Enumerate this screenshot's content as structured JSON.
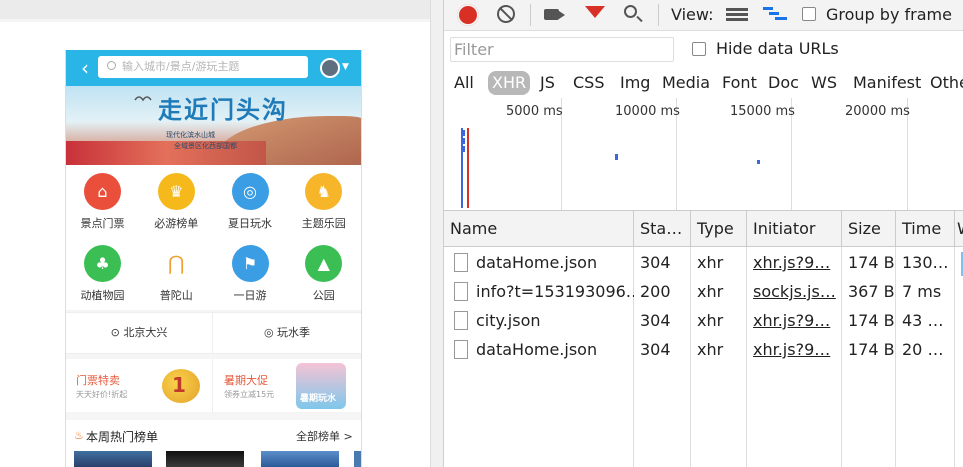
{
  "phone": {
    "back_icon": "‹",
    "search_placeholder": "输入城市/景点/游玩主题",
    "banner": {
      "title": "走近门头沟",
      "sub1": "现代化滨水山城",
      "sub2": "全域景区化西部国都"
    },
    "grid": [
      {
        "label": "景点门票",
        "icon": "temple-icon",
        "color": "#e94f3a",
        "glyph": "⌂"
      },
      {
        "label": "必游榜单",
        "icon": "crown-icon",
        "color": "#f5b91c",
        "glyph": "♛"
      },
      {
        "label": "夏日玩水",
        "icon": "diving-mask-icon",
        "color": "#3b9de3",
        "glyph": "◎"
      },
      {
        "label": "主题乐园",
        "icon": "rocking-horse-icon",
        "color": "#f7b52a",
        "glyph": "♞"
      },
      {
        "label": "动植物园",
        "icon": "tree-icon",
        "color": "#3bbf55",
        "glyph": "♣"
      },
      {
        "label": "普陀山",
        "icon": "mountain-icon",
        "color": "#ffffff",
        "glyph": "⋂"
      },
      {
        "label": "一日游",
        "icon": "flag-icon",
        "color": "#3b9de3",
        "glyph": "⚑"
      },
      {
        "label": "公园",
        "icon": "park-icon",
        "color": "#3bbf55",
        "glyph": "▲"
      }
    ],
    "location1": "北京大兴",
    "location2": "玩水季",
    "promo1": {
      "title": "门票特卖",
      "sub": "天天好价!折起"
    },
    "promo2": {
      "title": "暑期大促",
      "sub": "领券立减15元",
      "badge": "暑期玩水"
    },
    "hot": {
      "title": "本周热门榜单",
      "more": "全部榜单 >"
    }
  },
  "devtools": {
    "toolbar": {
      "view_label": "View:",
      "group_by_frame": "Group by frame"
    },
    "filter_placeholder": "Filter",
    "hide_data_urls": "Hide data URLs",
    "type_filters": [
      "All",
      "XHR",
      "JS",
      "CSS",
      "Img",
      "Media",
      "Font",
      "Doc",
      "WS",
      "Manifest",
      "Othe"
    ],
    "active_filter": "XHR",
    "timeline_ticks": [
      "5000 ms",
      "10000 ms",
      "15000 ms",
      "20000 ms"
    ],
    "columns": [
      "Name",
      "Sta…",
      "Type",
      "Initiator",
      "Size",
      "Time",
      "W"
    ],
    "rows": [
      {
        "name": "dataHome.json",
        "status": "304",
        "type": "xhr",
        "initiator": "xhr.js?9…",
        "size": "174 B",
        "time": "130…"
      },
      {
        "name": "info?t=153193096…",
        "status": "200",
        "type": "xhr",
        "initiator": "sockjs.js…",
        "size": "367 B",
        "time": "7 ms"
      },
      {
        "name": "city.json",
        "status": "304",
        "type": "xhr",
        "initiator": "xhr.js?9…",
        "size": "174 B",
        "time": "43 …"
      },
      {
        "name": "dataHome.json",
        "status": "304",
        "type": "xhr",
        "initiator": "xhr.js?9…",
        "size": "174 B",
        "time": "20 …"
      }
    ]
  }
}
